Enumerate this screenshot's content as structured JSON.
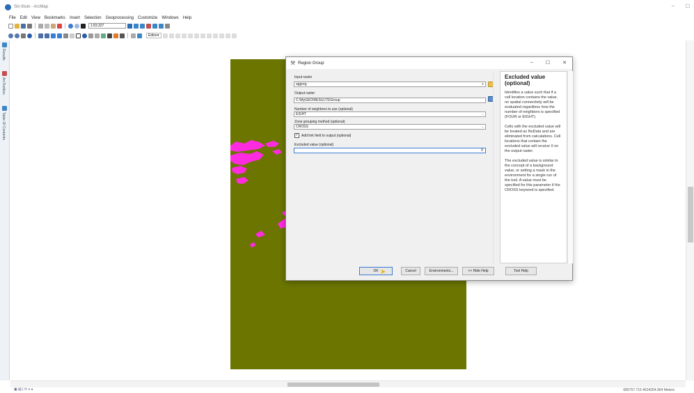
{
  "window": {
    "title": "Sin título - ArcMap",
    "minimize": "–",
    "maximize": "☐"
  },
  "menu": [
    "File",
    "Edit",
    "View",
    "Bookmarks",
    "Insert",
    "Selection",
    "Geoprocessing",
    "Customize",
    "Windows",
    "Help"
  ],
  "toolbar": {
    "scale": "1:83.327",
    "editor_label": "Editor▾"
  },
  "left_dock": {
    "tabs": [
      "Results",
      "ArcToolbox",
      "Table Of Contents"
    ]
  },
  "dialog": {
    "title": "Region Group",
    "minimize": "–",
    "maximize": "☐",
    "close": "✕",
    "fields": {
      "input_raster": {
        "label": "Input raster",
        "value": "aggreg"
      },
      "output_raster": {
        "label": "Output raster",
        "value": "C:\\MyGEO\\RESULTS\\Group"
      },
      "neighbors": {
        "label": "Number of neighbors to use (optional)",
        "value": "EIGHT"
      },
      "grouping": {
        "label": "Zone grouping method (optional)",
        "value": "CROSS"
      },
      "add_link": {
        "label": "Add link field to output (optional)",
        "checked": true
      },
      "excluded": {
        "label": "Excluded value (optional)",
        "value": "0"
      }
    },
    "help": {
      "title": "Excluded value (optional)",
      "paragraphs": [
        "Identifies a value such that if a cell location contains the value, no spatial connectivity will be evaluated regardless how the number of neighbors is specified (FOUR or EIGHT).",
        "Cells with the excluded value will be treated as NoData and are eliminated from calculations. Cell locations that contain the excluded value will receive 0 on the output raster.",
        "The excluded value is similar to the concept of a background value, or setting a mask in the environment for a single run of the tool. A value must be specified for this parameter if the CROSS keyword is specified."
      ]
    },
    "buttons": {
      "ok": "OK",
      "cancel": "Cancel",
      "environments": "Environments...",
      "hide_help": "<< Hide Help",
      "tool_help": "Tool Help"
    }
  },
  "status": {
    "coords": "685757.716  4624264.964 Meters"
  },
  "colors": {
    "raster": "#6b7500",
    "zones": "#ff2be0",
    "accent": "#3a7bd5"
  }
}
